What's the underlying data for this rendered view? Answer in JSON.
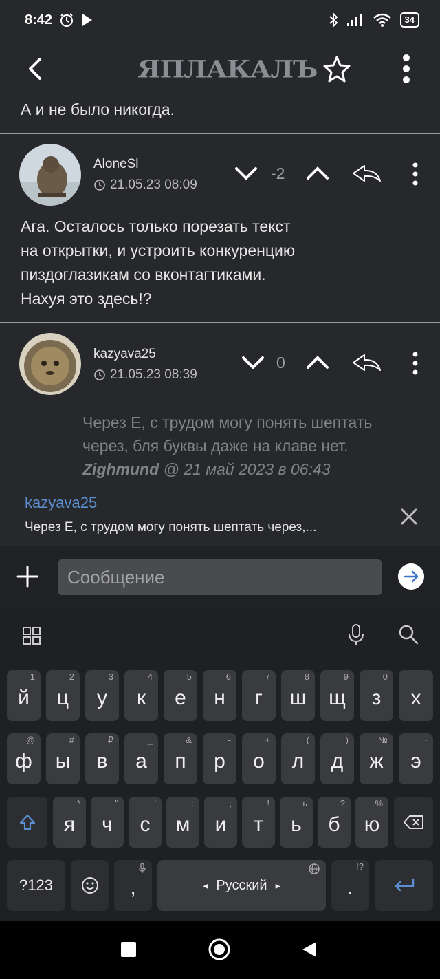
{
  "status": {
    "time": "8:42",
    "battery": "34"
  },
  "app": {
    "logo_text": "ЯПЛАКАЛЪ"
  },
  "feed": {
    "prev_tail": "А и не было никогда.",
    "comments": [
      {
        "author": "AloneSl",
        "date": "21.05.23 08:09",
        "score": "-2",
        "text_lines": [
          "Ага. Осталось только порезать текст",
          "на открытки, и устроить конкуренцию",
          "пиздоглазикам со вконтагтиками.",
          "Нахуя это здесь!?"
        ]
      },
      {
        "author": "kazyava25",
        "date": "21.05.23 08:39",
        "score": "0",
        "quote_lines": [
          "Через Е, с трудом могу понять шептать",
          "через, бля буквы даже на клаве нет."
        ],
        "quote_author": "Zighmund",
        "quote_rest": " @ 21 май 2023 в 06:43"
      }
    ]
  },
  "reply": {
    "author": "kazyava25",
    "snippet": "Через Е, с трудом могу понять шептать через,..."
  },
  "composer": {
    "placeholder": "Сообщение"
  },
  "keyboard": {
    "row1": [
      {
        "k": "й",
        "s": "1"
      },
      {
        "k": "ц",
        "s": "2"
      },
      {
        "k": "у",
        "s": "3"
      },
      {
        "k": "к",
        "s": "4"
      },
      {
        "k": "е",
        "s": "5"
      },
      {
        "k": "н",
        "s": "6"
      },
      {
        "k": "г",
        "s": "7"
      },
      {
        "k": "ш",
        "s": "8"
      },
      {
        "k": "щ",
        "s": "9"
      },
      {
        "k": "з",
        "s": "0"
      },
      {
        "k": "х",
        "s": ""
      }
    ],
    "row2": [
      {
        "k": "ф",
        "s": "@"
      },
      {
        "k": "ы",
        "s": "#"
      },
      {
        "k": "в",
        "s": "₽"
      },
      {
        "k": "а",
        "s": "_"
      },
      {
        "k": "п",
        "s": "&"
      },
      {
        "k": "р",
        "s": "-"
      },
      {
        "k": "о",
        "s": "+"
      },
      {
        "k": "л",
        "s": "("
      },
      {
        "k": "д",
        "s": ")"
      },
      {
        "k": "ж",
        "s": "№"
      },
      {
        "k": "э",
        "s": "~"
      }
    ],
    "row3": [
      {
        "k": "я",
        "s": "*"
      },
      {
        "k": "ч",
        "s": "\""
      },
      {
        "k": "с",
        "s": "'"
      },
      {
        "k": "м",
        "s": ":"
      },
      {
        "k": "и",
        "s": ";"
      },
      {
        "k": "т",
        "s": "!"
      },
      {
        "k": "ь",
        "s": "ъ"
      },
      {
        "k": "б",
        "s": "?"
      },
      {
        "k": "ю",
        "s": "%"
      }
    ],
    "symbols_key": "?123",
    "comma": ",",
    "space_label": "Русский",
    "period": ".",
    "period_sub": "!?"
  },
  "colors": {
    "accent": "#5b8fd1",
    "background": "#27282b"
  }
}
